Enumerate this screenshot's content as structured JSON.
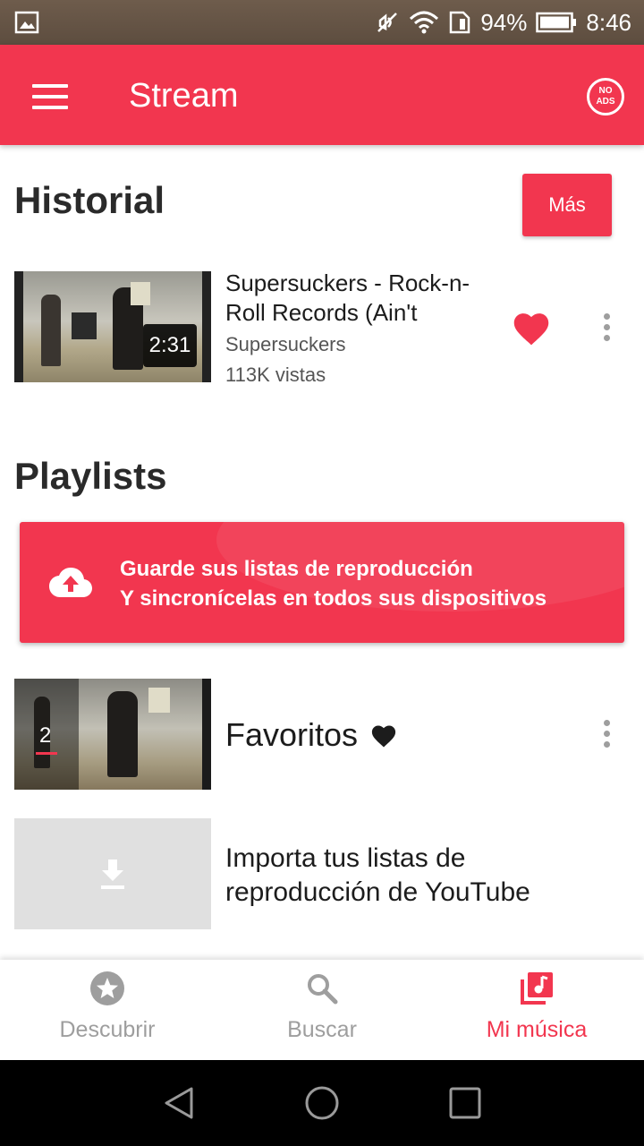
{
  "status_bar": {
    "battery": "94%",
    "time": "8:46"
  },
  "app_bar": {
    "title": "Stream",
    "noads_line1": "NO",
    "noads_line2": "ADS"
  },
  "history": {
    "title": "Historial",
    "more_label": "Más",
    "video": {
      "title": "Supersuckers - Rock-n-Roll Records (Ain't",
      "channel": "Supersuckers",
      "views": "113K vistas",
      "duration": "2:31"
    }
  },
  "playlists": {
    "title": "Playlists",
    "banner_line1": "Guarde sus listas de reproducción",
    "banner_line2": "Y sincronícelas en todos sus dispositivos",
    "favorites": {
      "name": "Favoritos",
      "count": "2"
    },
    "import_label": "Importa tus listas de reproducción de YouTube"
  },
  "bottom_nav": {
    "items": [
      {
        "label": "Descubrir",
        "icon": "star-icon"
      },
      {
        "label": "Buscar",
        "icon": "search-icon"
      },
      {
        "label": "Mi música",
        "icon": "music-library-icon"
      }
    ],
    "active_index": 2
  },
  "colors": {
    "accent": "#f2364f",
    "inactive": "#9e9e9e"
  }
}
